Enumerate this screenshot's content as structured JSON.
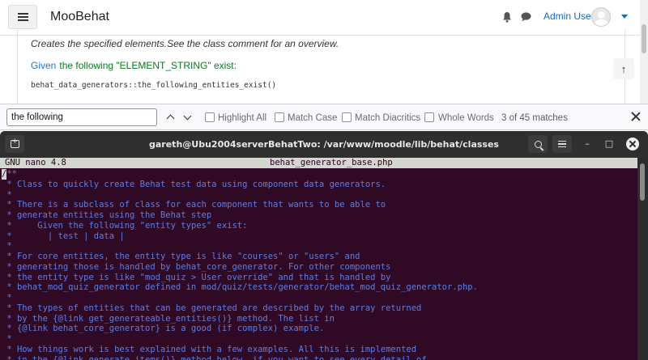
{
  "browser_page": {
    "site_name": "MooBehat",
    "user_name": "Admin User",
    "description": "Creates the specified elements.See the class comment for an overview.",
    "step_keyword": "Given",
    "step_text": "the following \"ELEMENT_STRING\" exist:",
    "step_code": "behat_data_generators::the_following_entities_exist()",
    "back_to_top_icon": "arrow-up-icon"
  },
  "findbar": {
    "query": "the following",
    "highlight_all": "Highlight All",
    "match_case": "Match Case",
    "match_diacritics": "Match Diacritics",
    "whole_words": "Whole Words",
    "match_count": "3 of 45 matches"
  },
  "terminal": {
    "title": "gareth@Ubu2004serverBehatTwo: /var/www/moodle/lib/behat/classes",
    "nano_version": "GNU nano 4.8",
    "file_name": "behat_generator_base.php",
    "lines": [
      "/**",
      " * Class to quickly create Behat test data using component data generators.",
      " *",
      " * There is a subclass of class for each component that wants to be able to",
      " * generate entities using the Behat step",
      " *     Given the following \"entity types\" exist:",
      " *       | test | data |",
      " *",
      " * For core entities, the entity type is like \"courses\" or \"users\" and",
      " * generating those is handled by behat_core_generator. For other components",
      " * the entity type is like \"mod_quiz > User override\" and that is handled by",
      " * behat_mod_quiz_generator defined in mod/quiz/tests/generator/behat_mod_quiz_generator.php.",
      " *",
      " * The types of entities that can be generated are described by the array returned",
      " * by the {@link get_generateable_entities()} method. The list in",
      " * {@link behat_core_generator} is a good (if complex) example.",
      " *",
      " * How things work is best explained with a few examples. All this is implemented",
      " * in the {@link generate_items()} method below, if you want to see every detail of"
    ]
  },
  "colors": {
    "terminal_bg": "#300a24",
    "comment_text": "#5e7de6",
    "link": "#0f6cbf",
    "step_text": "#0a7a24"
  }
}
